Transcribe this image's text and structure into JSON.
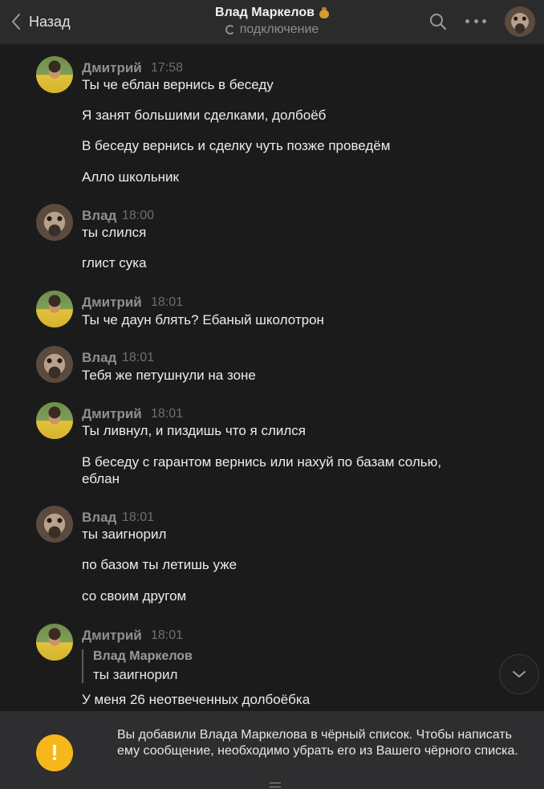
{
  "header": {
    "back_label": "Назад",
    "title": "Влад Маркелов",
    "title_emoji": "money-bag-icon",
    "status": "подключение"
  },
  "messages": [
    {
      "sender": "Дмитрий",
      "time": "17:58",
      "avatar": "dmitry-avatar",
      "lines": [
        "Ты че еблан вернись в беседу",
        "Я занят большими сделками, долбоёб",
        "В беседу вернись и сделку чуть позже проведём",
        "Алло школьник"
      ]
    },
    {
      "sender": "Влад",
      "time": "18:00",
      "avatar": "vlad-avatar",
      "lines": [
        "ты слился",
        "глист сука"
      ]
    },
    {
      "sender": "Дмитрий",
      "time": "18:01",
      "avatar": "dmitry-avatar",
      "lines": [
        "Ты че даун блять? Ебаный школотрон"
      ]
    },
    {
      "sender": "Влад",
      "time": "18:01",
      "avatar": "vlad-avatar",
      "lines": [
        "Тебя же петушнули на зоне"
      ]
    },
    {
      "sender": "Дмитрий",
      "time": "18:01",
      "avatar": "dmitry-avatar",
      "lines": [
        "Ты ливнул, и пиздишь что я слился",
        "В беседу с гарантом вернись или нахуй по базам солью, еблан"
      ]
    },
    {
      "sender": "Влад",
      "time": "18:01",
      "avatar": "vlad-avatar",
      "lines": [
        "ты заигнорил",
        "по базом ты летишь уже",
        "со своим другом"
      ]
    },
    {
      "sender": "Дмитрий",
      "time": "18:01",
      "avatar": "dmitry-avatar",
      "reply": {
        "name": "Влад Маркелов",
        "text": "ты заигнорил"
      },
      "lines": [
        "У меня 26 неотвеченных долбоёбка"
      ]
    }
  ],
  "footer": {
    "notice": "Вы добавили Влада Маркелова в чёрный список. Чтобы написать ему сообщение, необходимо убрать его из Вашего чёрного списка."
  },
  "colors": {
    "background": "#1b1b1c",
    "header": "#2b2b2c",
    "footer": "#2e2e30",
    "warning": "#f6b71b"
  }
}
